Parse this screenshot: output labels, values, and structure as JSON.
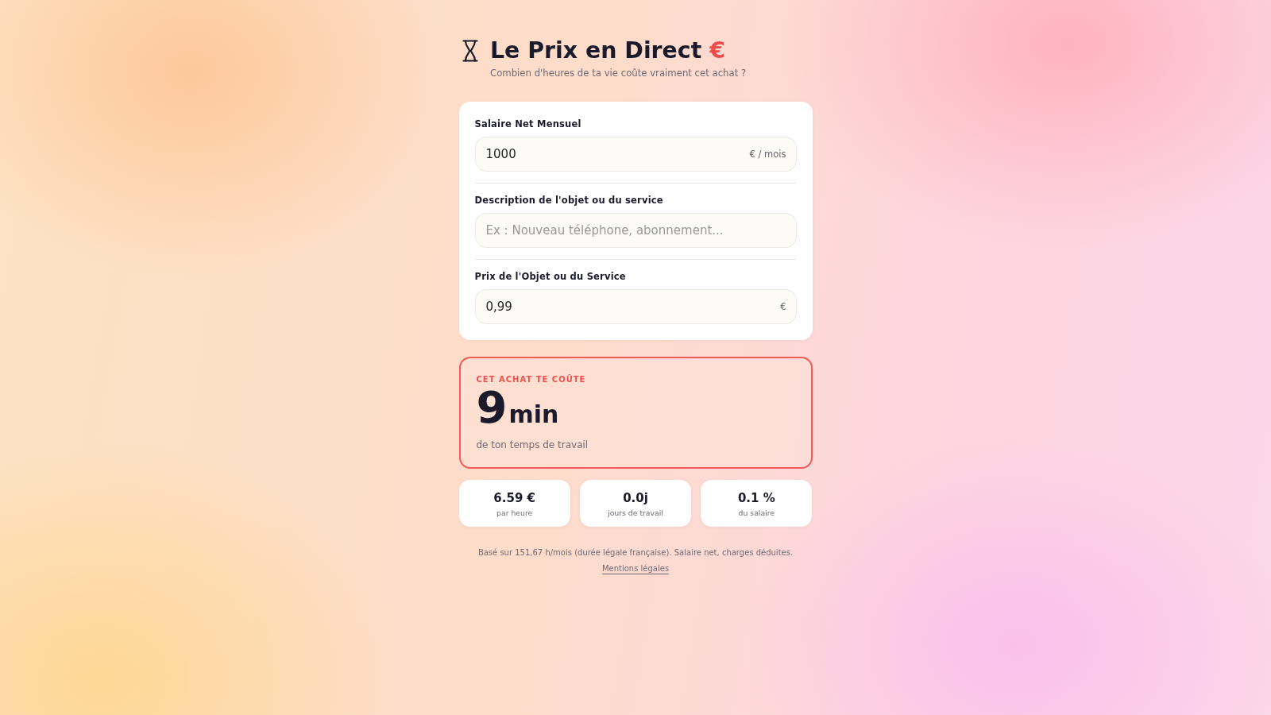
{
  "header": {
    "title": "Le Prix en Direct",
    "title_accent": "€",
    "subtitle": "Combien d'heures de ta vie coûte vraiment cet achat ?"
  },
  "form": {
    "fields": [
      {
        "label": "Salaire Net Mensuel",
        "value": "1000",
        "unit": "€ / mois"
      },
      {
        "label": "Description de l'objet ou du service",
        "placeholder": "Ex : Nouveau téléphone, abonnement..."
      },
      {
        "label": "Prix de l'Objet ou du Service",
        "value": "0,99",
        "unit": "€"
      }
    ]
  },
  "result": {
    "heading": "CET ACHAT TE COÛTE",
    "amount": "9",
    "unit": "min",
    "caption": "de ton temps de travail"
  },
  "stats": [
    {
      "value": "6.59 €",
      "label": "par heure"
    },
    {
      "value": "0.0j",
      "label": "jours de travail"
    },
    {
      "value": "0.1 %",
      "label": "du salaire"
    }
  ],
  "footer": {
    "note": "Basé sur 151,67 h/mois (durée légale française). Salaire net, charges déduites.",
    "link": "Mentions légales"
  }
}
